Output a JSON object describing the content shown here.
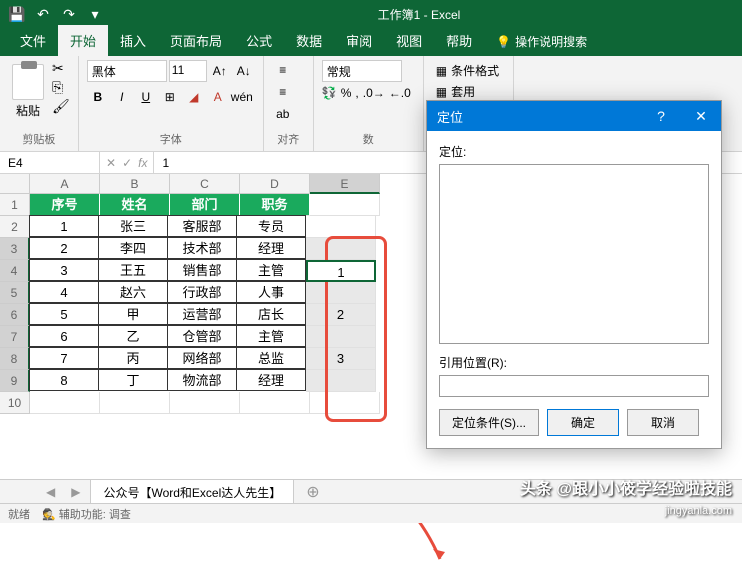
{
  "titlebar": {
    "title": "工作簿1 - Excel"
  },
  "tabs": [
    "文件",
    "开始",
    "插入",
    "页面布局",
    "公式",
    "数据",
    "审阅",
    "视图",
    "帮助"
  ],
  "tell_me": "操作说明搜索",
  "ribbon": {
    "clipboard": {
      "paste": "粘贴",
      "label": "剪贴板"
    },
    "font": {
      "name": "黑体",
      "size": "11",
      "label": "字体"
    },
    "alignment": {
      "label": "对齐"
    },
    "number": {
      "format": "常规",
      "label": "数"
    },
    "styles": {
      "cond_format": "条件格式",
      "table_format": "套用"
    }
  },
  "formula_bar": {
    "ref": "E4",
    "value": "1"
  },
  "columns": [
    "A",
    "B",
    "C",
    "D",
    "E"
  ],
  "table": {
    "headers": [
      "序号",
      "姓名",
      "部门",
      "职务"
    ],
    "rows": [
      [
        "1",
        "张三",
        "客服部",
        "专员"
      ],
      [
        "2",
        "李四",
        "技术部",
        "经理"
      ],
      [
        "3",
        "王五",
        "销售部",
        "主管"
      ],
      [
        "4",
        "赵六",
        "行政部",
        "人事"
      ],
      [
        "5",
        "甲",
        "运营部",
        "店长"
      ],
      [
        "6",
        "乙",
        "仓管部",
        "主管"
      ],
      [
        "7",
        "丙",
        "网络部",
        "总监"
      ],
      [
        "8",
        "丁",
        "物流部",
        "经理"
      ]
    ],
    "col_e": {
      "r4": "1",
      "r6": "2",
      "r8": "3"
    }
  },
  "dialog": {
    "title": "定位",
    "label_list": "定位:",
    "label_ref": "引用位置(R):",
    "ref_value": "",
    "btn_conditions": "定位条件(S)...",
    "btn_ok": "确定",
    "btn_cancel": "取消"
  },
  "sheet_tab": "公众号【Word和Excel达人先生】",
  "status": {
    "ready": "就绪",
    "acc": "辅助功能: 调查"
  },
  "watermark": {
    "line1": "头条 @跟小小筱学经验啦技能",
    "line2": "jingyanla.com"
  }
}
